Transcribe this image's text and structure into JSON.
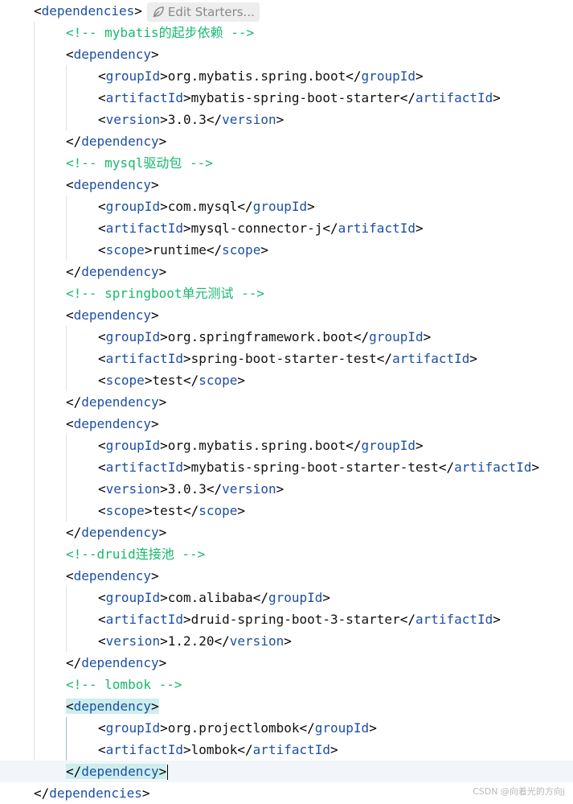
{
  "codelens": {
    "label": "Edit Starters...",
    "icon": "leaf-icon"
  },
  "watermark": "CSDN @向着光的方向j",
  "colors": {
    "tag": "#1d4fa3",
    "comment": "#18b86f",
    "highlight": "#cdeeed",
    "current_line": "#f2f6fb"
  },
  "lines": [
    {
      "indent": 1,
      "tokens": [
        {
          "t": "<",
          "k": "punct"
        },
        {
          "t": "dependencies",
          "k": "tag"
        },
        {
          "t": ">",
          "k": "punct"
        }
      ],
      "codelens": true
    },
    {
      "indent": 2,
      "tokens": [
        {
          "t": "<!-- mybatis的起步依赖 -->",
          "k": "comment"
        }
      ]
    },
    {
      "indent": 2,
      "tokens": [
        {
          "t": "<",
          "k": "punct"
        },
        {
          "t": "dependency",
          "k": "tag"
        },
        {
          "t": ">",
          "k": "punct"
        }
      ]
    },
    {
      "indent": 3,
      "tokens": [
        {
          "t": "<",
          "k": "punct"
        },
        {
          "t": "groupId",
          "k": "tag"
        },
        {
          "t": ">",
          "k": "punct"
        },
        {
          "t": "org.mybatis.spring.boot",
          "k": "text"
        },
        {
          "t": "</",
          "k": "punct"
        },
        {
          "t": "groupId",
          "k": "tag"
        },
        {
          "t": ">",
          "k": "punct"
        }
      ]
    },
    {
      "indent": 3,
      "tokens": [
        {
          "t": "<",
          "k": "punct"
        },
        {
          "t": "artifactId",
          "k": "tag"
        },
        {
          "t": ">",
          "k": "punct"
        },
        {
          "t": "mybatis-spring-boot-starter",
          "k": "text"
        },
        {
          "t": "</",
          "k": "punct"
        },
        {
          "t": "artifactId",
          "k": "tag"
        },
        {
          "t": ">",
          "k": "punct"
        }
      ]
    },
    {
      "indent": 3,
      "tokens": [
        {
          "t": "<",
          "k": "punct"
        },
        {
          "t": "version",
          "k": "tag"
        },
        {
          "t": ">",
          "k": "punct"
        },
        {
          "t": "3.0.3",
          "k": "text"
        },
        {
          "t": "</",
          "k": "punct"
        },
        {
          "t": "version",
          "k": "tag"
        },
        {
          "t": ">",
          "k": "punct"
        }
      ]
    },
    {
      "indent": 2,
      "tokens": [
        {
          "t": "</",
          "k": "punct"
        },
        {
          "t": "dependency",
          "k": "tag"
        },
        {
          "t": ">",
          "k": "punct"
        }
      ]
    },
    {
      "indent": 2,
      "tokens": [
        {
          "t": "<!-- mysql驱动包 -->",
          "k": "comment"
        }
      ]
    },
    {
      "indent": 2,
      "tokens": [
        {
          "t": "<",
          "k": "punct"
        },
        {
          "t": "dependency",
          "k": "tag"
        },
        {
          "t": ">",
          "k": "punct"
        }
      ]
    },
    {
      "indent": 3,
      "tokens": [
        {
          "t": "<",
          "k": "punct"
        },
        {
          "t": "groupId",
          "k": "tag"
        },
        {
          "t": ">",
          "k": "punct"
        },
        {
          "t": "com.mysql",
          "k": "text"
        },
        {
          "t": "</",
          "k": "punct"
        },
        {
          "t": "groupId",
          "k": "tag"
        },
        {
          "t": ">",
          "k": "punct"
        }
      ]
    },
    {
      "indent": 3,
      "tokens": [
        {
          "t": "<",
          "k": "punct"
        },
        {
          "t": "artifactId",
          "k": "tag"
        },
        {
          "t": ">",
          "k": "punct"
        },
        {
          "t": "mysql-connector-j",
          "k": "text"
        },
        {
          "t": "</",
          "k": "punct"
        },
        {
          "t": "artifactId",
          "k": "tag"
        },
        {
          "t": ">",
          "k": "punct"
        }
      ]
    },
    {
      "indent": 3,
      "tokens": [
        {
          "t": "<",
          "k": "punct"
        },
        {
          "t": "scope",
          "k": "tag"
        },
        {
          "t": ">",
          "k": "punct"
        },
        {
          "t": "runtime",
          "k": "text"
        },
        {
          "t": "</",
          "k": "punct"
        },
        {
          "t": "scope",
          "k": "tag"
        },
        {
          "t": ">",
          "k": "punct"
        }
      ]
    },
    {
      "indent": 2,
      "tokens": [
        {
          "t": "</",
          "k": "punct"
        },
        {
          "t": "dependency",
          "k": "tag"
        },
        {
          "t": ">",
          "k": "punct"
        }
      ]
    },
    {
      "indent": 2,
      "tokens": [
        {
          "t": "<!-- springboot单元测试 -->",
          "k": "comment"
        }
      ]
    },
    {
      "indent": 2,
      "tokens": [
        {
          "t": "<",
          "k": "punct"
        },
        {
          "t": "dependency",
          "k": "tag"
        },
        {
          "t": ">",
          "k": "punct"
        }
      ]
    },
    {
      "indent": 3,
      "tokens": [
        {
          "t": "<",
          "k": "punct"
        },
        {
          "t": "groupId",
          "k": "tag"
        },
        {
          "t": ">",
          "k": "punct"
        },
        {
          "t": "org.springframework.boot",
          "k": "text"
        },
        {
          "t": "</",
          "k": "punct"
        },
        {
          "t": "groupId",
          "k": "tag"
        },
        {
          "t": ">",
          "k": "punct"
        }
      ]
    },
    {
      "indent": 3,
      "tokens": [
        {
          "t": "<",
          "k": "punct"
        },
        {
          "t": "artifactId",
          "k": "tag"
        },
        {
          "t": ">",
          "k": "punct"
        },
        {
          "t": "spring-boot-starter-test",
          "k": "text"
        },
        {
          "t": "</",
          "k": "punct"
        },
        {
          "t": "artifactId",
          "k": "tag"
        },
        {
          "t": ">",
          "k": "punct"
        }
      ]
    },
    {
      "indent": 3,
      "tokens": [
        {
          "t": "<",
          "k": "punct"
        },
        {
          "t": "scope",
          "k": "tag"
        },
        {
          "t": ">",
          "k": "punct"
        },
        {
          "t": "test",
          "k": "text"
        },
        {
          "t": "</",
          "k": "punct"
        },
        {
          "t": "scope",
          "k": "tag"
        },
        {
          "t": ">",
          "k": "punct"
        }
      ]
    },
    {
      "indent": 2,
      "tokens": [
        {
          "t": "</",
          "k": "punct"
        },
        {
          "t": "dependency",
          "k": "tag"
        },
        {
          "t": ">",
          "k": "punct"
        }
      ]
    },
    {
      "indent": 2,
      "tokens": [
        {
          "t": "<",
          "k": "punct"
        },
        {
          "t": "dependency",
          "k": "tag"
        },
        {
          "t": ">",
          "k": "punct"
        }
      ]
    },
    {
      "indent": 3,
      "tokens": [
        {
          "t": "<",
          "k": "punct"
        },
        {
          "t": "groupId",
          "k": "tag"
        },
        {
          "t": ">",
          "k": "punct"
        },
        {
          "t": "org.mybatis.spring.boot",
          "k": "text"
        },
        {
          "t": "</",
          "k": "punct"
        },
        {
          "t": "groupId",
          "k": "tag"
        },
        {
          "t": ">",
          "k": "punct"
        }
      ]
    },
    {
      "indent": 3,
      "tokens": [
        {
          "t": "<",
          "k": "punct"
        },
        {
          "t": "artifactId",
          "k": "tag"
        },
        {
          "t": ">",
          "k": "punct"
        },
        {
          "t": "mybatis-spring-boot-starter-test",
          "k": "text"
        },
        {
          "t": "</",
          "k": "punct"
        },
        {
          "t": "artifactId",
          "k": "tag"
        },
        {
          "t": ">",
          "k": "punct"
        }
      ]
    },
    {
      "indent": 3,
      "tokens": [
        {
          "t": "<",
          "k": "punct"
        },
        {
          "t": "version",
          "k": "tag"
        },
        {
          "t": ">",
          "k": "punct"
        },
        {
          "t": "3.0.3",
          "k": "text"
        },
        {
          "t": "</",
          "k": "punct"
        },
        {
          "t": "version",
          "k": "tag"
        },
        {
          "t": ">",
          "k": "punct"
        }
      ]
    },
    {
      "indent": 3,
      "tokens": [
        {
          "t": "<",
          "k": "punct"
        },
        {
          "t": "scope",
          "k": "tag"
        },
        {
          "t": ">",
          "k": "punct"
        },
        {
          "t": "test",
          "k": "text"
        },
        {
          "t": "</",
          "k": "punct"
        },
        {
          "t": "scope",
          "k": "tag"
        },
        {
          "t": ">",
          "k": "punct"
        }
      ]
    },
    {
      "indent": 2,
      "tokens": [
        {
          "t": "</",
          "k": "punct"
        },
        {
          "t": "dependency",
          "k": "tag"
        },
        {
          "t": ">",
          "k": "punct"
        }
      ]
    },
    {
      "indent": 2,
      "tokens": [
        {
          "t": "<!--druid连接池 -->",
          "k": "comment"
        }
      ]
    },
    {
      "indent": 2,
      "tokens": [
        {
          "t": "<",
          "k": "punct"
        },
        {
          "t": "dependency",
          "k": "tag"
        },
        {
          "t": ">",
          "k": "punct"
        }
      ]
    },
    {
      "indent": 3,
      "tokens": [
        {
          "t": "<",
          "k": "punct"
        },
        {
          "t": "groupId",
          "k": "tag"
        },
        {
          "t": ">",
          "k": "punct"
        },
        {
          "t": "com.alibaba",
          "k": "text"
        },
        {
          "t": "</",
          "k": "punct"
        },
        {
          "t": "groupId",
          "k": "tag"
        },
        {
          "t": ">",
          "k": "punct"
        }
      ]
    },
    {
      "indent": 3,
      "tokens": [
        {
          "t": "<",
          "k": "punct"
        },
        {
          "t": "artifactId",
          "k": "tag"
        },
        {
          "t": ">",
          "k": "punct"
        },
        {
          "t": "druid-spring-boot-3-starter",
          "k": "text"
        },
        {
          "t": "</",
          "k": "punct"
        },
        {
          "t": "artifactId",
          "k": "tag"
        },
        {
          "t": ">",
          "k": "punct"
        }
      ]
    },
    {
      "indent": 3,
      "tokens": [
        {
          "t": "<",
          "k": "punct"
        },
        {
          "t": "version",
          "k": "tag"
        },
        {
          "t": ">",
          "k": "punct"
        },
        {
          "t": "1.2.20",
          "k": "text"
        },
        {
          "t": "</",
          "k": "punct"
        },
        {
          "t": "version",
          "k": "tag"
        },
        {
          "t": ">",
          "k": "punct"
        }
      ]
    },
    {
      "indent": 2,
      "tokens": [
        {
          "t": "</",
          "k": "punct"
        },
        {
          "t": "dependency",
          "k": "tag"
        },
        {
          "t": ">",
          "k": "punct"
        }
      ]
    },
    {
      "indent": 2,
      "tokens": [
        {
          "t": "<!-- lombok -->",
          "k": "comment"
        }
      ]
    },
    {
      "indent": 2,
      "tokens": [
        {
          "t": "<",
          "k": "punct",
          "hl": true
        },
        {
          "t": "dependency",
          "k": "tag",
          "hl": true
        },
        {
          "t": ">",
          "k": "punct",
          "hl": true
        }
      ]
    },
    {
      "indent": 3,
      "tokens": [
        {
          "t": "<",
          "k": "punct"
        },
        {
          "t": "groupId",
          "k": "tag"
        },
        {
          "t": ">",
          "k": "punct"
        },
        {
          "t": "org.projectlombok",
          "k": "text"
        },
        {
          "t": "</",
          "k": "punct"
        },
        {
          "t": "groupId",
          "k": "tag"
        },
        {
          "t": ">",
          "k": "punct"
        }
      ]
    },
    {
      "indent": 3,
      "tokens": [
        {
          "t": "<",
          "k": "punct"
        },
        {
          "t": "artifactId",
          "k": "tag"
        },
        {
          "t": ">",
          "k": "punct"
        },
        {
          "t": "lombok",
          "k": "text"
        },
        {
          "t": "</",
          "k": "punct"
        },
        {
          "t": "artifactId",
          "k": "tag"
        },
        {
          "t": ">",
          "k": "punct"
        }
      ]
    },
    {
      "indent": 2,
      "tokens": [
        {
          "t": "</",
          "k": "punct",
          "hl": true
        },
        {
          "t": "dependency",
          "k": "tag",
          "hl": true
        },
        {
          "t": ">",
          "k": "punct",
          "hl": true
        }
      ],
      "current": true,
      "caret": true
    },
    {
      "indent": 1,
      "tokens": [
        {
          "t": "</",
          "k": "punct"
        },
        {
          "t": "dependencies",
          "k": "tag"
        },
        {
          "t": ">",
          "k": "punct"
        }
      ]
    }
  ]
}
